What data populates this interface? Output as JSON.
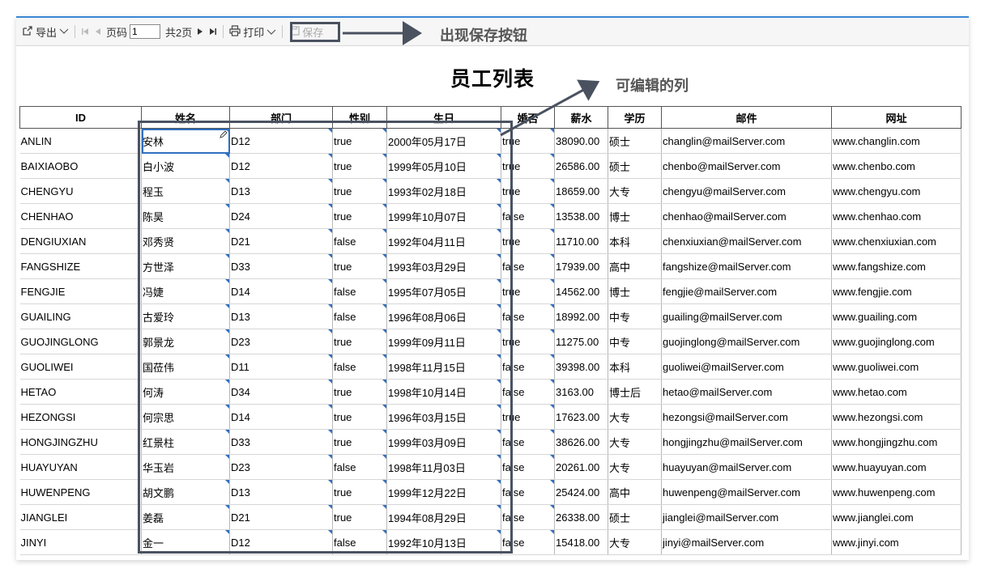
{
  "toolbar": {
    "export": {
      "icon": "export-icon",
      "label": "导出",
      "chevron": "chevron-down-icon"
    },
    "nav_first": "first-page-icon",
    "nav_prev": "prev-page-icon",
    "page_label": "页码",
    "page_value": "1",
    "total_pages": "共2页",
    "nav_next": "next-page-icon",
    "nav_last": "last-page-icon",
    "print": {
      "icon": "printer-icon",
      "label": "打印"
    },
    "save": {
      "icon": "save-icon",
      "label": "保存"
    }
  },
  "annotations": {
    "save_callout": "出现保存按钮",
    "editable_callout": "可编辑的列",
    "box_color": "#4a5260"
  },
  "report": {
    "title": "员工列表",
    "columns": [
      "ID",
      "姓名",
      "部门",
      "性别",
      "生日",
      "婚否",
      "薪水",
      "学历",
      "邮件",
      "网址"
    ],
    "rows": [
      [
        "ANLIN",
        "安林",
        "D12",
        "true",
        "2000年05月17日",
        "true",
        "38090.00",
        "硕士",
        "changlin@mailServer.com",
        "www.changlin.com"
      ],
      [
        "BAIXIAOBO",
        "白小波",
        "D12",
        "true",
        "1999年05月10日",
        "true",
        "26586.00",
        "硕士",
        "chenbo@mailServer.com",
        "www.chenbo.com"
      ],
      [
        "CHENGYU",
        "程玉",
        "D13",
        "true",
        "1993年02月18日",
        "true",
        "18659.00",
        "大专",
        "chengyu@mailServer.com",
        "www.chengyu.com"
      ],
      [
        "CHENHAO",
        "陈昊",
        "D24",
        "true",
        "1999年10月07日",
        "false",
        "13538.00",
        "博士",
        "chenhao@mailServer.com",
        "www.chenhao.com"
      ],
      [
        "DENGIUXIAN",
        "邓秀贤",
        "D21",
        "false",
        "1992年04月11日",
        "true",
        "11710.00",
        "本科",
        "chenxiuxian@mailServer.com",
        "www.chenxiuxian.com"
      ],
      [
        "FANGSHIZE",
        "方世泽",
        "D33",
        "true",
        "1993年03月29日",
        "false",
        "17939.00",
        "高中",
        "fangshize@mailServer.com",
        "www.fangshize.com"
      ],
      [
        "FENGJIE",
        "冯婕",
        "D14",
        "false",
        "1995年07月05日",
        "true",
        "14562.00",
        "博士",
        "fengjie@mailServer.com",
        "www.fengjie.com"
      ],
      [
        "GUAILING",
        "古爱玲",
        "D13",
        "false",
        "1996年08月06日",
        "false",
        "18992.00",
        "中专",
        "guailing@mailServer.com",
        "www.guailing.com"
      ],
      [
        "GUOJINGLONG",
        "郭景龙",
        "D23",
        "true",
        "1999年09月11日",
        "true",
        "11275.00",
        "中专",
        "guojinglong@mailServer.com",
        "www.guojinglong.com"
      ],
      [
        "GUOLIWEI",
        "国莅伟",
        "D11",
        "false",
        "1998年11月15日",
        "false",
        "39398.00",
        "本科",
        "guoliwei@mailServer.com",
        "www.guoliwei.com"
      ],
      [
        "HETAO",
        "何涛",
        "D34",
        "true",
        "1998年10月14日",
        "false",
        "3163.00",
        "博士后",
        "hetao@mailServer.com",
        "www.hetao.com"
      ],
      [
        "HEZONGSI",
        "何宗思",
        "D14",
        "true",
        "1996年03月15日",
        "true",
        "17623.00",
        "大专",
        "hezongsi@mailServer.com",
        "www.hezongsi.com"
      ],
      [
        "HONGJINGZHU",
        "红景柱",
        "D33",
        "true",
        "1999年03月09日",
        "false",
        "38626.00",
        "大专",
        "hongjingzhu@mailServer.com",
        "www.hongjingzhu.com"
      ],
      [
        "HUAYUYAN",
        "华玉岩",
        "D23",
        "false",
        "1998年11月03日",
        "false",
        "20261.00",
        "大专",
        "huayuyan@mailServer.com",
        "www.huayuyan.com"
      ],
      [
        "HUWENPENG",
        "胡文鹏",
        "D13",
        "true",
        "1999年12月22日",
        "false",
        "25424.00",
        "高中",
        "huwenpeng@mailServer.com",
        "www.huwenpeng.com"
      ],
      [
        "JIANGLEI",
        "姜磊",
        "D21",
        "true",
        "1994年08月29日",
        "false",
        "26338.00",
        "硕士",
        "jianglei@mailServer.com",
        "www.jianglei.com"
      ],
      [
        "JINYI",
        "金一",
        "D12",
        "false",
        "1992年10月13日",
        "false",
        "15418.00",
        "大专",
        "jinyi@mailServer.com",
        "www.jinyi.com"
      ]
    ]
  }
}
